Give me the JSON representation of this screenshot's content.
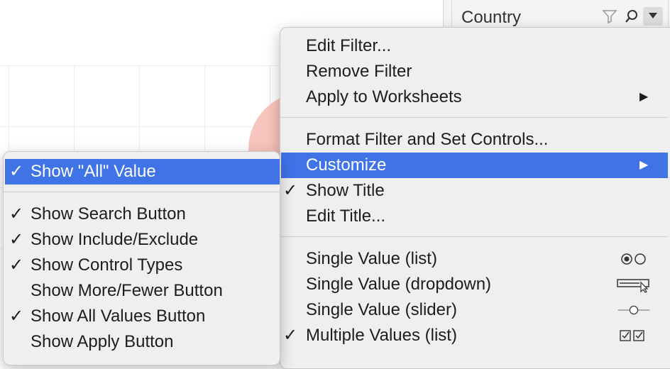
{
  "filter": {
    "title": "Country"
  },
  "main_menu": {
    "items": [
      {
        "label": "Edit Filter...",
        "checked": false
      },
      {
        "label": "Remove Filter",
        "checked": false
      },
      {
        "label": "Apply to Worksheets",
        "checked": false,
        "submenu": true
      },
      {
        "label": "Format Filter and Set Controls...",
        "checked": false
      },
      {
        "label": "Customize",
        "checked": false,
        "submenu": true,
        "highlighted": true
      },
      {
        "label": "Show Title",
        "checked": true
      },
      {
        "label": "Edit Title...",
        "checked": false
      },
      {
        "label": "Single Value (list)",
        "checked": false,
        "icon": "radio-buttons-icon"
      },
      {
        "label": "Single Value (dropdown)",
        "checked": false,
        "icon": "dropdown-control-icon"
      },
      {
        "label": "Single Value (slider)",
        "checked": false,
        "icon": "slider-control-icon"
      },
      {
        "label": "Multiple Values (list)",
        "checked": true,
        "icon": "checkboxes-icon"
      }
    ],
    "check_glyph": "✓",
    "arrow_glyph": "▶"
  },
  "sub_menu": {
    "items": [
      {
        "label": "Show \"All\" Value",
        "checked": true,
        "highlighted": true
      },
      {
        "label": "Show Search Button",
        "checked": true
      },
      {
        "label": "Show Include/Exclude",
        "checked": true
      },
      {
        "label": "Show Control Types",
        "checked": true
      },
      {
        "label": "Show More/Fewer Button",
        "checked": false
      },
      {
        "label": "Show All Values Button",
        "checked": true
      },
      {
        "label": "Show Apply Button",
        "checked": false
      }
    ]
  },
  "colors": {
    "highlight": "#3f73e6",
    "menu_bg": "#efefef",
    "bubble": "#f6c5bd"
  }
}
